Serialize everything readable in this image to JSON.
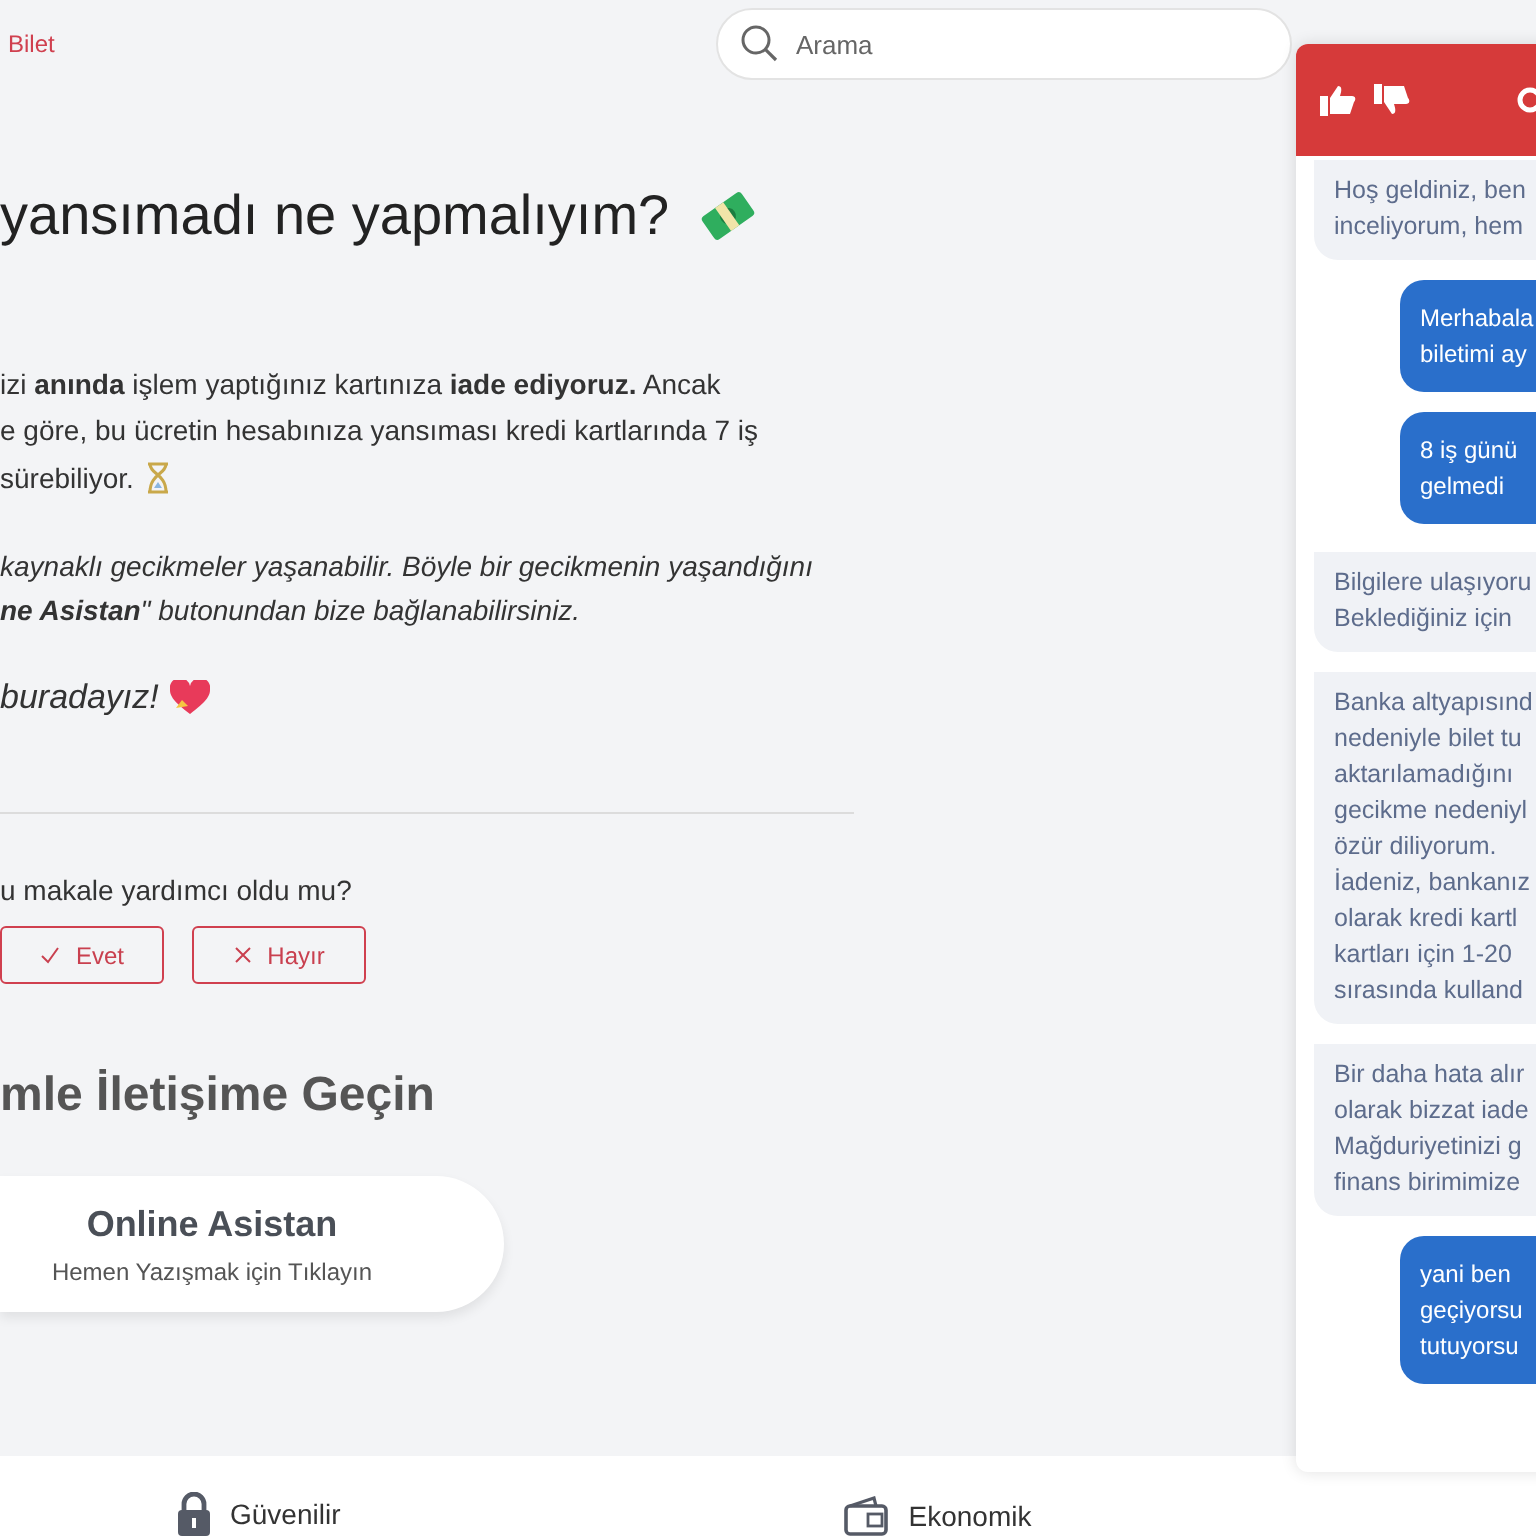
{
  "breadcrumb": "Bilet",
  "search": {
    "placeholder": "Arama"
  },
  "article": {
    "title": "yansımadı ne yapmalıyım?",
    "paragraphs": [
      {
        "kind": "plain",
        "lines": [
          "izi **anında** işlem yaptığınız kartınıza **iade ediyoruz.** Ancak",
          "e göre, bu ücretin hesabınıza yansıması kredi kartlarında 7 iş",
          "sürebiliyor."
        ]
      },
      {
        "kind": "italic",
        "lines": [
          "kaynaklı gecikmeler yaşanabilir. Böyle bir gecikmenin yaşandığını",
          "**ne Asistan**\" butonundan bize bağlanabilirsiniz."
        ]
      },
      {
        "kind": "closing",
        "lines": [
          "buradayız!"
        ]
      }
    ]
  },
  "feedback": {
    "question": "u makale yardımcı oldu mu?",
    "buttons": [
      {
        "label": "Evet",
        "kind": "yes"
      },
      {
        "label": "Hayır",
        "kind": "no"
      }
    ]
  },
  "contact": {
    "heading": "mle İletişime Geçin",
    "card": {
      "title": "Online Asistan",
      "subtitle": "Hemen Yazışmak için Tıklayın"
    }
  },
  "footer": [
    {
      "label": "Güvenilir",
      "kind": "lock"
    },
    {
      "label": "Ekonomik",
      "kind": "wallet"
    }
  ],
  "chat": {
    "messages": [
      {
        "kind": "bot",
        "lines": [
          "Hoş geldiniz, ben",
          "inceliyorum, hem"
        ]
      },
      {
        "kind": "user",
        "lines": [
          "Merhabala",
          "biletimi ay"
        ]
      },
      {
        "kind": "user",
        "lines": [
          "8 iş günü",
          "gelmedi"
        ]
      },
      {
        "kind": "bot",
        "lines": [
          "Bilgilere ulaşıyoru",
          "Beklediğiniz için"
        ]
      },
      {
        "kind": "bot",
        "lines": [
          "Banka altyapısınd",
          "nedeniyle bilet tu",
          "aktarılamadığını",
          "gecikme nedeniyl",
          "özür diliyorum.",
          "İadeniz, bankanız",
          "olarak kredi kartl",
          "kartları için 1-20",
          "sırasında kulland"
        ]
      },
      {
        "kind": "bot",
        "lines": [
          "Bir daha hata alır",
          "olarak bizzat iade",
          "Mağduriyetinizi g",
          "finans birimimize"
        ]
      },
      {
        "kind": "user",
        "lines": [
          "yani ben",
          "geçiyorsu",
          "tutuyorsu"
        ]
      }
    ]
  }
}
